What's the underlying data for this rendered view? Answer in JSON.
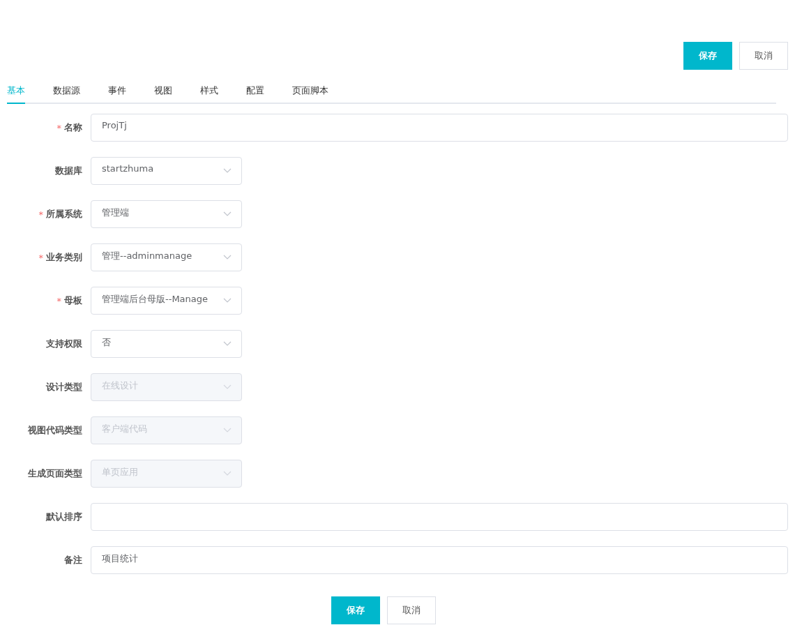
{
  "top_actions": [
    {
      "label": "保存",
      "kind": "primary"
    },
    {
      "label": "取消",
      "kind": "default"
    }
  ],
  "tabs": [
    {
      "label": "基本",
      "selected": true
    },
    {
      "label": "数据源",
      "selected": false
    },
    {
      "label": "事件",
      "selected": false
    },
    {
      "label": "视图",
      "selected": false
    },
    {
      "label": "样式",
      "selected": false
    },
    {
      "label": "配置",
      "selected": false
    },
    {
      "label": "页面脚本",
      "selected": false
    }
  ],
  "fields": [
    {
      "label": "名称",
      "required_marker": "*",
      "kind": "text",
      "value": "ProjTj"
    },
    {
      "label": "数据库",
      "kind": "select",
      "value": "startzhuma",
      "disabled": false
    },
    {
      "label": "所属系统",
      "required_marker": "*",
      "kind": "select",
      "value": "管理端",
      "disabled": false
    },
    {
      "label": "业务类别",
      "required_marker": "*",
      "kind": "select",
      "value": "管理--adminmanage",
      "disabled": false
    },
    {
      "label": "母板",
      "required_marker": "*",
      "kind": "select",
      "value": "管理端后台母版--Manage",
      "disabled": false
    },
    {
      "label": "支持权限",
      "kind": "select",
      "value": "否",
      "disabled": false
    },
    {
      "label": "设计类型",
      "kind": "select",
      "value": "在线设计",
      "disabled": true
    },
    {
      "label": "视图代码类型",
      "kind": "select",
      "value": "客户端代码",
      "disabled": true
    },
    {
      "label": "生成页面类型",
      "kind": "select",
      "value": "单页应用",
      "disabled": true
    },
    {
      "label": "默认排序",
      "kind": "text"
    },
    {
      "label": "备注",
      "kind": "text",
      "value": "项目统计"
    }
  ],
  "bottom_actions": [
    {
      "label": "保存",
      "kind": "primary"
    },
    {
      "label": "取消",
      "kind": "default"
    }
  ]
}
